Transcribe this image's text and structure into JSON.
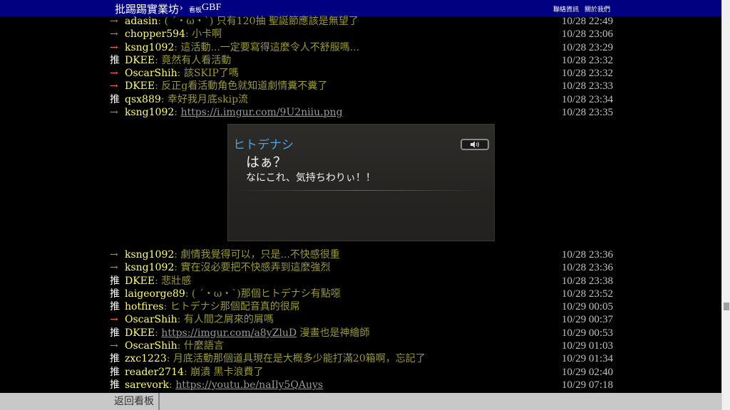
{
  "topbar": {
    "brand": "批踢踢實業坊",
    "separator": "›",
    "board_prefix": "看板",
    "board_name": "GBF",
    "links": [
      "聯絡資訊",
      "關於我們"
    ]
  },
  "pushes_top": [
    {
      "tag": "→",
      "type": "arrow",
      "user": "adasin",
      "content": ": ( ´・ω・`) 只有120抽 聖誕節應該是無望了",
      "time": "10/28 22:49"
    },
    {
      "tag": "→",
      "type": "arrow",
      "user": "chopper594",
      "content": ": 小卡啊",
      "time": "10/28 23:06"
    },
    {
      "tag": "→",
      "type": "arrow",
      "user": "ksng1092",
      "content": ": 這活動...一定要寫得這麼令人不舒服嗎...",
      "time": "10/28 23:29"
    },
    {
      "tag": "推",
      "type": "up",
      "user": "DKEE",
      "content": ": 竟然有人看活動",
      "time": "10/28 23:32"
    },
    {
      "tag": "→",
      "type": "arrow",
      "user": "OscarShih",
      "content": ": 該SKIP了嗎",
      "time": "10/28 23:32"
    },
    {
      "tag": "→",
      "type": "arrow",
      "user": "DKEE",
      "content": ": 反正g看活動角色就知道劇情糞不糞了",
      "time": "10/28 23:33"
    },
    {
      "tag": "推",
      "type": "up",
      "user": "qsx889",
      "content": ": 幸好我月底skip流",
      "time": "10/28 23:34"
    },
    {
      "tag": "→",
      "type": "arrow",
      "user": "ksng1092",
      "content": ": ",
      "link": "https://i.imgur.com/9U2niiu.png",
      "time": "10/28 23:35"
    }
  ],
  "embed": {
    "speaker": "ヒトデナシ",
    "line1": "はぁ？",
    "line2": "なにこれ、気持ちわりぃ！！",
    "voice_icon": "speaker-icon"
  },
  "pushes_bottom": [
    {
      "tag": "→",
      "type": "arrow",
      "user": "ksng1092",
      "content": ": 劇情我覺得可以，只是...不快感很重",
      "time": "10/28 23:36"
    },
    {
      "tag": "→",
      "type": "arrow",
      "user": "ksng1092",
      "content": ": 實在沒必要把不快感弄到這麼強烈",
      "time": "10/28 23:36"
    },
    {
      "tag": "推",
      "type": "up",
      "user": "DKEE",
      "content": ": 悲壯感",
      "time": "10/28 23:38"
    },
    {
      "tag": "推",
      "type": "up",
      "user": "laigeorge89",
      "content": ": ( ´・ω・`)那個ヒトデナシ有點噁",
      "time": "10/28 23:52"
    },
    {
      "tag": "推",
      "type": "up",
      "user": "hotfires",
      "content": ": ヒトデナシ那個配音真的很屌",
      "time": "10/29 00:05"
    },
    {
      "tag": "→",
      "type": "arrow",
      "user": "OscarShih",
      "content": ": 有人間之屑來的屑嗎",
      "time": "10/29 00:37"
    },
    {
      "tag": "推",
      "type": "up",
      "user": "DKEE",
      "content": ": ",
      "link": "https://imgur.com/a8yZluD",
      "content_after": " 漫畫也是神繪師",
      "time": "10/29 00:53"
    },
    {
      "tag": "→",
      "type": "arrow",
      "user": "OscarShih",
      "content": ": 什麼語言",
      "time": "10/29 01:03"
    },
    {
      "tag": "推",
      "type": "up",
      "user": "zxc1223",
      "content": ": 月底活動那個道具現在是大概多少能打滿20箱啊，忘記了",
      "time": "10/29 01:34"
    },
    {
      "tag": "推",
      "type": "up",
      "user": "reader2714",
      "content": ": 崩潰 黑卡浪費了",
      "time": "10/29 02:40"
    },
    {
      "tag": "推",
      "type": "up",
      "user": "sarevork",
      "content": ": ",
      "link": "https://youtu.be/naIly5QAuys",
      "time": "10/29 07:18"
    }
  ],
  "bottombar": {
    "back_label": "返回看板"
  }
}
